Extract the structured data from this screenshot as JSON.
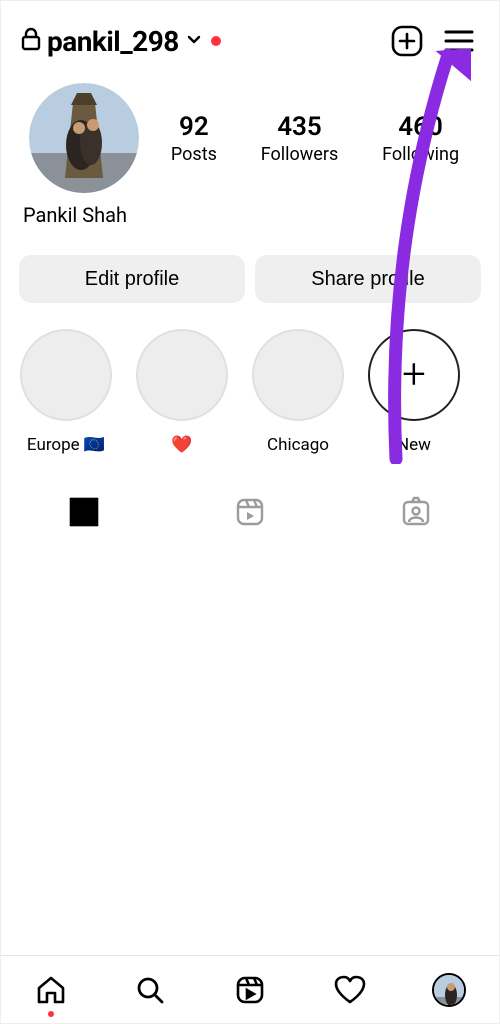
{
  "header": {
    "username": "pankil_298"
  },
  "profile": {
    "display_name": "Pankil Shah",
    "stats": {
      "posts": {
        "count": "92",
        "label": "Posts"
      },
      "followers": {
        "count": "435",
        "label": "Followers"
      },
      "following": {
        "count": "460",
        "label": "Following"
      }
    }
  },
  "actions": {
    "edit": "Edit profile",
    "share": "Share profile"
  },
  "highlights": [
    {
      "label": "Europe 🇪🇺"
    },
    {
      "label": "❤️"
    },
    {
      "label": "Chicago"
    }
  ],
  "highlight_new_label": "New"
}
